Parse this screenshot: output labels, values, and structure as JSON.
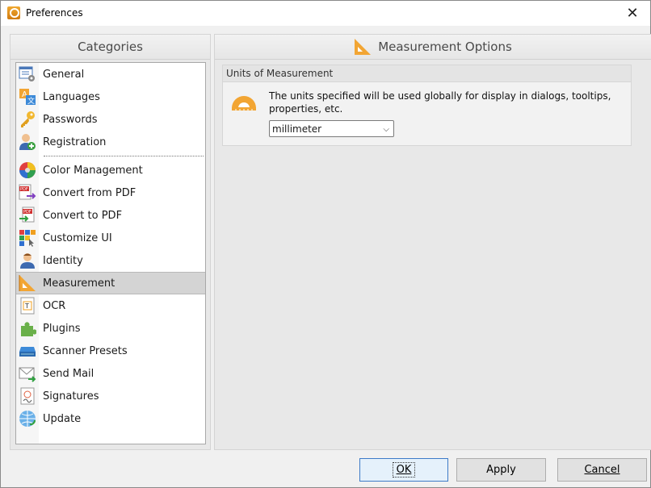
{
  "window": {
    "title": "Preferences"
  },
  "categories": {
    "header": "Categories",
    "items": [
      {
        "label": "General",
        "icon": "general-settings-icon"
      },
      {
        "label": "Languages",
        "icon": "languages-icon"
      },
      {
        "label": "Passwords",
        "icon": "key-icon"
      },
      {
        "label": "Registration",
        "icon": "user-add-icon"
      },
      {
        "label": "Color Management",
        "icon": "color-wheel-icon"
      },
      {
        "label": "Convert from PDF",
        "icon": "pdf-export-icon"
      },
      {
        "label": "Convert to PDF",
        "icon": "pdf-import-icon"
      },
      {
        "label": "Customize UI",
        "icon": "customize-ui-icon"
      },
      {
        "label": "Identity",
        "icon": "identity-icon"
      },
      {
        "label": "Measurement",
        "icon": "ruler-triangle-icon"
      },
      {
        "label": "OCR",
        "icon": "ocr-icon"
      },
      {
        "label": "Plugins",
        "icon": "puzzle-icon"
      },
      {
        "label": "Scanner Presets",
        "icon": "scanner-icon"
      },
      {
        "label": "Send Mail",
        "icon": "mail-icon"
      },
      {
        "label": "Signatures",
        "icon": "signature-icon"
      },
      {
        "label": "Update",
        "icon": "globe-update-icon"
      }
    ],
    "selected": "Measurement"
  },
  "options": {
    "header": "Measurement Options",
    "group_title": "Units of Measurement",
    "description": "The units specified will be used globally for display in dialogs, tooltips, properties, etc.",
    "unit_value": "millimeter"
  },
  "buttons": {
    "ok": "OK",
    "apply": "Apply",
    "cancel": "Cancel"
  },
  "colors": {
    "accent": "#3d7ac7",
    "selected_bg": "#d4d4d4",
    "icon_orange": "#f2a533"
  }
}
